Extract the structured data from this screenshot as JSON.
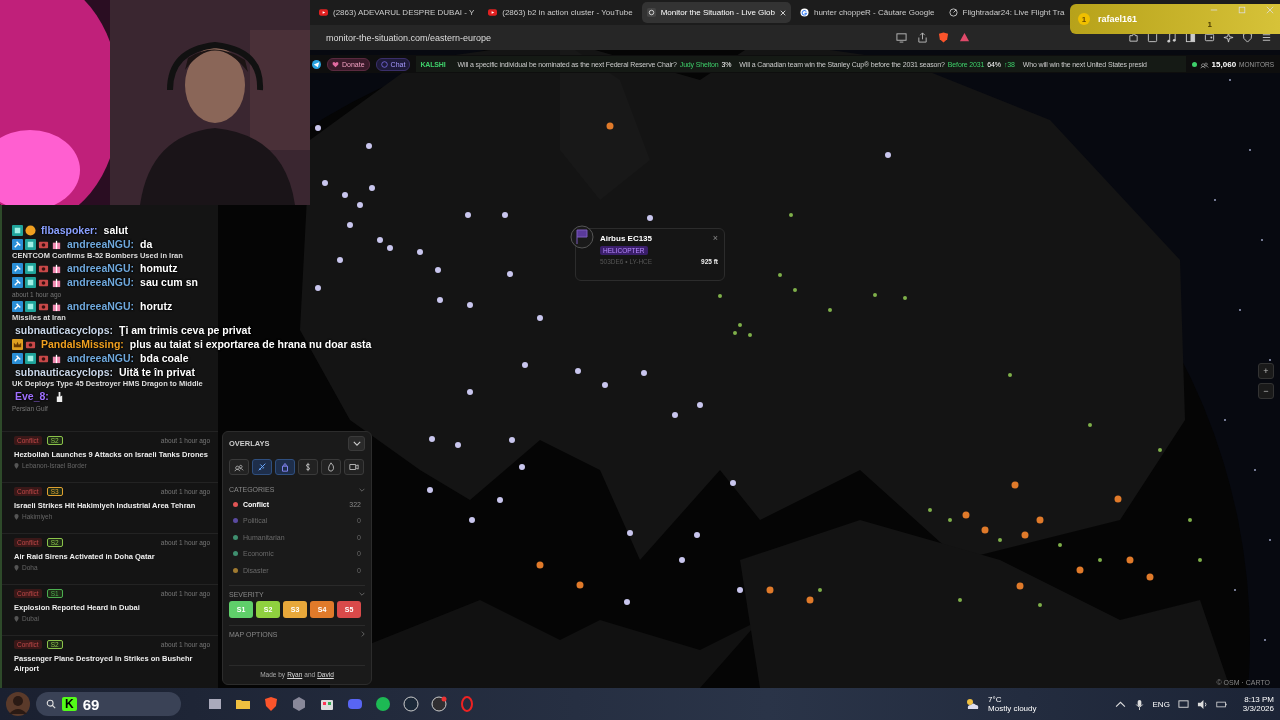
{
  "browser": {
    "tabs": [
      {
        "title": "(2863) ADEVARUL DESPRE DUBAI - Y",
        "selected": false
      },
      {
        "title": "(2863) b2 in action cluster - YouTube",
        "selected": false
      },
      {
        "title": "Monitor the Situation - Live Glob",
        "selected": true
      },
      {
        "title": "hunter choppeR - Căutare Google",
        "selected": false
      },
      {
        "title": "Flightradar24: Live Flight Tra",
        "selected": false
      }
    ],
    "address": "monitor-the-situation.com/eastern-europe"
  },
  "alert": {
    "badge": "1",
    "user": "rafael161",
    "count": "1"
  },
  "topbar": {
    "donate": "Donate",
    "chat": "Chat",
    "source": "KALSHI",
    "ticker": [
      {
        "question": "Will a specific individual be nominated as the next Federal Reserve Chair?",
        "answer": "Judy Shelton",
        "percent": "3%"
      },
      {
        "question": "Will a Canadian team win the Stanley Cup® before the 2031 season?",
        "answer": "Before 2031",
        "percent": "64%",
        "change": "↑38"
      },
      {
        "question": "Who will win the next United States presid"
      }
    ],
    "monitors_count": "15,060",
    "monitors_label": "MONITORS"
  },
  "chat_overlay": [
    {
      "kind": "chat",
      "user": "flbaspoker:",
      "color": "#8aa0ff",
      "text": "salut"
    },
    {
      "kind": "chat",
      "user": "andreeaNGU:",
      "color": "#6fa8dc",
      "text": "da"
    },
    {
      "kind": "headline",
      "text": "CENTCOM Confirms B-52 Bombers Used in Iran"
    },
    {
      "kind": "chat",
      "user": "andreeaNGU:",
      "color": "#6fa8dc",
      "text": "homutz"
    },
    {
      "kind": "chat",
      "user": "andreeaNGU:",
      "color": "#6fa8dc",
      "text": "sau cum sn"
    },
    {
      "kind": "meta",
      "text": "about 1 hour ago"
    },
    {
      "kind": "chat",
      "user": "andreeaNGU:",
      "color": "#6fa8dc",
      "text": "horutz"
    },
    {
      "kind": "headline",
      "text": "Missiles at Iran"
    },
    {
      "kind": "chat",
      "user": "subnauticacyclops:",
      "color": "#c9d6e8",
      "text": "Ţi am trimis ceva pe privat"
    },
    {
      "kind": "chat",
      "user": "PandaIsMissing:",
      "color": "#f0a020",
      "text": "plus au taiat si exportarea de hrana nu doar asta"
    },
    {
      "kind": "chat",
      "user": "andreeaNGU:",
      "color": "#6fa8dc",
      "text": "bda coale"
    },
    {
      "kind": "chat",
      "user": "subnauticacyclops:",
      "color": "#c9d6e8",
      "text": "Uită te în privat"
    },
    {
      "kind": "headline",
      "text": "UK Deploys Type 45 Destroyer HMS Dragon to Middle"
    },
    {
      "kind": "chat",
      "user": "Eve_8:",
      "color": "#a070ff"
    },
    {
      "kind": "meta",
      "text": "Persian Gulf"
    }
  ],
  "feed": [
    {
      "tag": "Conflict",
      "severity": "S2",
      "color": "#8bc34a",
      "time": "about 1 hour ago",
      "title": "Hezbollah Launches 9 Attacks on Israeli Tanks Drones",
      "location": "Lebanon-Israel Border"
    },
    {
      "tag": "Conflict",
      "severity": "S3",
      "color": "#e0a030",
      "time": "about 1 hour ago",
      "title": "Israeli Strikes Hit Hakimiyeh Industrial Area Tehran",
      "location": "Hakimiyeh"
    },
    {
      "tag": "Conflict",
      "severity": "S2",
      "color": "#8bc34a",
      "time": "about 1 hour ago",
      "title": "Air Raid Sirens Activated in Doha Qatar",
      "location": "Doha"
    },
    {
      "tag": "Conflict",
      "severity": "S1",
      "color": "#4caf50",
      "time": "about 1 hour ago",
      "title": "Explosion Reported Heard in Dubai",
      "location": "Dubai"
    },
    {
      "tag": "Conflict",
      "severity": "S2",
      "color": "#8bc34a",
      "time": "about 1 hour ago",
      "title": "Passenger Plane Destroyed in Strikes on Bushehr Airport"
    }
  ],
  "overlays": {
    "title": "OVERLAYS",
    "buttons": [
      {
        "selected": false
      },
      {
        "selected": true
      },
      {
        "selected": true
      },
      {
        "selected": false
      },
      {
        "selected": false
      },
      {
        "selected": false
      }
    ],
    "categories_title": "CATEGORIES",
    "categories": [
      {
        "name": "Conflict",
        "count": "322",
        "color": "#e05555",
        "active": true
      },
      {
        "name": "Political",
        "count": "0",
        "color": "#5a4aa0",
        "active": false
      },
      {
        "name": "Humanitarian",
        "count": "0",
        "color": "#3f8f6f",
        "active": false
      },
      {
        "name": "Economic",
        "count": "0",
        "color": "#3f8f6f",
        "active": false
      },
      {
        "name": "Disaster",
        "count": "0",
        "color": "#a07a30",
        "active": false
      }
    ],
    "severity_title": "SEVERITY",
    "severity": [
      {
        "label": "S1",
        "color": "#5fcf6a"
      },
      {
        "label": "S2",
        "color": "#8fd13f"
      },
      {
        "label": "S3",
        "color": "#e8a83a"
      },
      {
        "label": "S4",
        "color": "#e07a2a"
      },
      {
        "label": "S5",
        "color": "#d94a4a"
      }
    ],
    "map_options": "MAP OPTIONS",
    "credit_prefix": "Made by",
    "credit_name1": "Ryan",
    "credit_and": "and",
    "credit_name2": "David"
  },
  "popup": {
    "title": "Airbus EC135",
    "tag": "HELICOPTER",
    "ids": "503DE6 • LY-HCE",
    "altitude": "925 ft",
    "close": "×"
  },
  "map": {
    "zoom_in": "+",
    "zoom_out": "−",
    "attribution": "© OSM · CARTO"
  },
  "taskbar": {
    "kick": "K",
    "viewers": "69",
    "temp": "7°C",
    "weather": "Mostly cloudy",
    "language": "ENG",
    "time": "8:13 PM",
    "date": "3/3/2026"
  }
}
